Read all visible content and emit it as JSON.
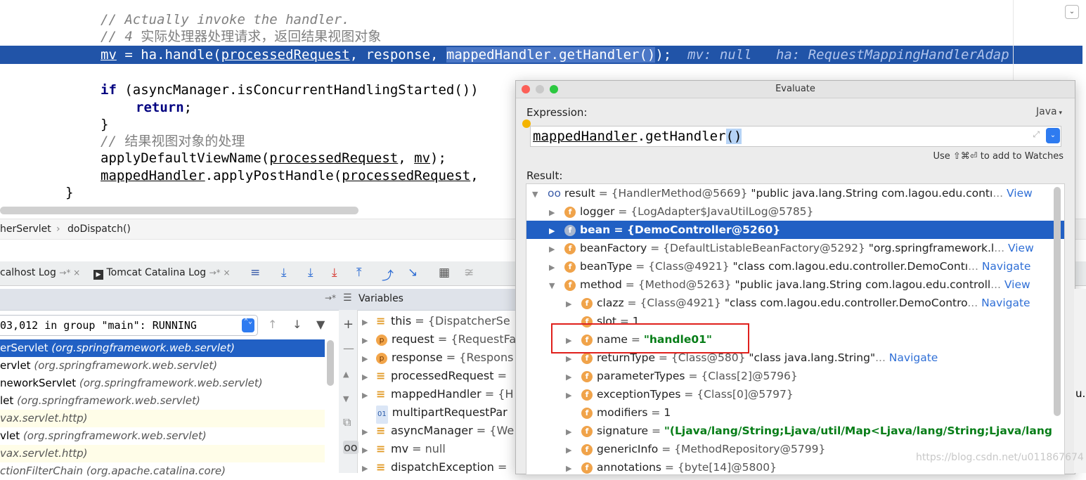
{
  "editor": {
    "line1_comment": "// Actually invoke the handler.",
    "line2_comment_prefix": "// 4 ",
    "line2_comment_cn": "实际处理器处理请求，返回结果视图对象",
    "exec_line": {
      "p1": "mv",
      "p2": " = ha.handle(",
      "p3": "processedRequest",
      "p4": ", response, ",
      "p5": "mappedHandler.getHandler()",
      "p6": ");",
      "hint": "  mv: null   ha: RequestMappingHandlerAdap"
    },
    "if_kw": "if",
    "if_rest": " (asyncManager.isConcurrentHandlingStarted())",
    "return_kw": "return",
    "return_rest": ";",
    "close_brace": "}",
    "comment3_prefix": "// ",
    "comment3_cn": "结果视图对象的处理",
    "apply1_a": "applyDefaultViewName(",
    "apply1_b": "processedRequest",
    "apply1_c": ", ",
    "apply1_d": "mv",
    "apply1_e": ");",
    "apply2_a": "mappedHandler",
    "apply2_b": ".applyPostHandle(",
    "apply2_c": "processedRequest",
    "apply2_d": ",",
    "outer_brace": "}"
  },
  "breadcrumb": {
    "item1": "herServlet",
    "separator": "›",
    "item2": "doDispatch()"
  },
  "tabs": {
    "tab1": "calhost Log",
    "tab1_suffix": "→* ×",
    "tab2": "Tomcat Catalina Log",
    "tab2_suffix": "→* ×"
  },
  "variables_header": {
    "arrow": "→*",
    "label": "Variables"
  },
  "thread": {
    "label": "03,012 in group \"main\": RUNNING"
  },
  "frames": [
    {
      "method": "erServlet",
      "pkg": "(org.springframework.web.servlet)",
      "state": "active"
    },
    {
      "method": "ervlet",
      "pkg": "(org.springframework.web.servlet)",
      "state": "normal"
    },
    {
      "method": "neworkServlet",
      "pkg": "(org.springframework.web.servlet)",
      "state": "normal"
    },
    {
      "method": "let",
      "pkg": "(org.springframework.web.servlet)",
      "state": "normal"
    },
    {
      "method": "",
      "pkg": "vax.servlet.http)",
      "state": "lib"
    },
    {
      "method": "vlet",
      "pkg": "(org.springframework.web.servlet)",
      "state": "normal"
    },
    {
      "method": "",
      "pkg": "vax.servlet.http)",
      "state": "lib"
    },
    {
      "method": "",
      "pkg": "ctionFilterChain (org.apache.catalina.core)",
      "state": "normal"
    }
  ],
  "variables": [
    {
      "badge": "lines",
      "name": "this",
      "value": "= {DispatcherSe"
    },
    {
      "badge": "p",
      "name": "request",
      "value": "= {RequestFa"
    },
    {
      "badge": "p",
      "name": "response",
      "value": "= {Respons"
    },
    {
      "badge": "lines",
      "name": "processedRequest",
      "value": "="
    },
    {
      "badge": "lines",
      "name": "mappedHandler",
      "value": "= {H"
    },
    {
      "badge": "01",
      "name": "multipartRequestPar",
      "value": ""
    },
    {
      "badge": "lines",
      "name": "asyncManager",
      "value": "= {We"
    },
    {
      "badge": "lines",
      "name": "mv",
      "value": "= null"
    },
    {
      "badge": "lines",
      "name": "dispatchException",
      "value": "="
    }
  ],
  "dialog": {
    "title": "Evaluate",
    "expression_label": "Expression:",
    "language": "Java",
    "expression_a": "mappedHandler",
    "expression_b": ".getHandler",
    "expression_c": "()",
    "watch_hint": "Use ⇧⌘⏎ to add to Watches",
    "result_label": "Result:"
  },
  "result_rows": [
    {
      "indent": 0,
      "tri": "▼",
      "badge": "oo",
      "name": "result",
      "eq": " = ",
      "ref": "{HandlerMethod@5669}",
      "val": " \"public java.lang.String com.lagou.edu.contı",
      "ell": "...",
      "link": " View"
    },
    {
      "indent": 1,
      "tri": "▶",
      "badge": "f",
      "name": "logger",
      "eq": " = ",
      "ref": "{LogAdapter$JavaUtilLog@5785}",
      "val": "",
      "ell": "",
      "link": ""
    },
    {
      "indent": 1,
      "tri": "▶",
      "badge": "f",
      "name": "bean",
      "eq": " = ",
      "ref": "{DemoController@5260}",
      "val": "",
      "ell": "",
      "link": "",
      "selected": true
    },
    {
      "indent": 1,
      "tri": "▶",
      "badge": "f",
      "name": "beanFactory",
      "eq": " = ",
      "ref": "{DefaultListableBeanFactory@5292}",
      "val": " \"org.springframework.l",
      "ell": "...",
      "link": " View"
    },
    {
      "indent": 1,
      "tri": "▶",
      "badge": "f",
      "name": "beanType",
      "eq": " = ",
      "ref": "{Class@4921}",
      "val": " \"class com.lagou.edu.controller.DemoContı",
      "ell": "...",
      "link": " Navigate"
    },
    {
      "indent": 1,
      "tri": "▼",
      "badge": "f",
      "name": "method",
      "eq": " = ",
      "ref": "{Method@5263}",
      "val": " \"public java.lang.String com.lagou.edu.controll",
      "ell": "...",
      "link": " View"
    },
    {
      "indent": 2,
      "tri": "▶",
      "badge": "f",
      "name": "clazz",
      "eq": " = ",
      "ref": "{Class@4921}",
      "val": " \"class com.lagou.edu.controller.DemoContro",
      "ell": "...",
      "link": " Navigate"
    },
    {
      "indent": 2,
      "tri": "",
      "badge": "f",
      "name": "slot",
      "eq": " = ",
      "ref": "",
      "val": "1",
      "ell": "",
      "link": ""
    },
    {
      "indent": 2,
      "tri": "▶",
      "badge": "f",
      "name": "name",
      "eq": " = ",
      "ref": "",
      "str": "\"handle01\"",
      "val": "",
      "ell": "",
      "link": ""
    },
    {
      "indent": 2,
      "tri": "▶",
      "badge": "f",
      "name": "returnType",
      "eq": " = ",
      "ref": "{Class@580}",
      "val": " \"class java.lang.String\"",
      "ell": "...",
      "link": " Navigate"
    },
    {
      "indent": 2,
      "tri": "▶",
      "badge": "f",
      "name": "parameterTypes",
      "eq": " = ",
      "ref": "{Class[2]@5796}",
      "val": "",
      "ell": "",
      "link": ""
    },
    {
      "indent": 2,
      "tri": "▶",
      "badge": "f",
      "name": "exceptionTypes",
      "eq": " = ",
      "ref": "{Class[0]@5797}",
      "val": "",
      "ell": "",
      "link": ""
    },
    {
      "indent": 2,
      "tri": "",
      "badge": "f",
      "name": "modifiers",
      "eq": " = ",
      "ref": "",
      "val": "1",
      "ell": "",
      "link": ""
    },
    {
      "indent": 2,
      "tri": "▶",
      "badge": "f",
      "name": "signature",
      "eq": " = ",
      "ref": "",
      "str": "\"(Ljava/lang/String;Ljava/util/Map<Ljava/lang/String;Ljava/lang",
      "val": "",
      "ell": "",
      "link": ""
    },
    {
      "indent": 2,
      "tri": "▶",
      "badge": "f",
      "name": "genericInfo",
      "eq": " = ",
      "ref": "{MethodRepository@5799}",
      "val": "",
      "ell": "",
      "link": ""
    },
    {
      "indent": 2,
      "tri": "▶",
      "badge": "f",
      "name": "annotations",
      "eq": " = ",
      "ref": "{byte[14]@5800}",
      "val": "",
      "ell": "",
      "link": ""
    }
  ],
  "watermark": "https://blog.csdn.net/u011867674",
  "right_edge_text": "u.",
  "colors": {
    "exec_line_bg": "#2154a8",
    "selection_bg": "#2160c4",
    "highlight_box": "#e0201c",
    "string_value": "#067d17",
    "link": "#2f6fd6"
  }
}
